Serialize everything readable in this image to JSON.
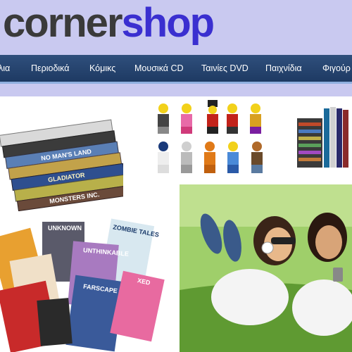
{
  "logo": {
    "part1": "corner",
    "part2": "shop"
  },
  "nav": {
    "items": [
      "λια",
      "Περιοδικά",
      "Κόμικς",
      "Μουσικά CD",
      "Ταινίες DVD",
      "Παιχνίδια",
      "Φιγούρ"
    ]
  },
  "dvd_titles": [
    "NO MAN'S LAND",
    "GLADIATOR",
    "MONSTERS INC."
  ],
  "comic_titles": [
    "UNKNOWN",
    "ZOMBIE TALES",
    "UNTHINKABLE",
    "FARSCAPE",
    "XED"
  ],
  "colors": {
    "header_bg": "#c9c9f0",
    "nav_bg": "#1e3a63",
    "logo_shop": "#3a2fd0",
    "logo_corner": "#3a3a3a"
  }
}
